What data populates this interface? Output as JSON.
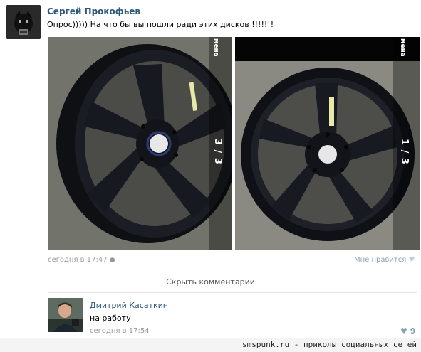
{
  "post": {
    "author": "Сергей Прокофьев",
    "text": "Опрос))))) На что бы вы пошли ради этих дисков !!!!!!!",
    "time": "сегодня в 17:47",
    "like_label": "Мне нравится",
    "photos": [
      {
        "counter": "3 / 3",
        "side_label": "мена"
      },
      {
        "counter": "1 / 3",
        "side_label": "мена"
      }
    ]
  },
  "comments_toggle": "Скрыть комментарии",
  "comment": {
    "author": "Дмитрий Касаткин",
    "text": "на работу",
    "time": "сегодня в 17:54",
    "likes": "9"
  },
  "watermark": "smspunk.ru - приколы социальных сетей",
  "colors": {
    "link": "#2b587a",
    "meta": "#999999",
    "wheel": "#15171c",
    "accent": "#8aa1b4"
  }
}
